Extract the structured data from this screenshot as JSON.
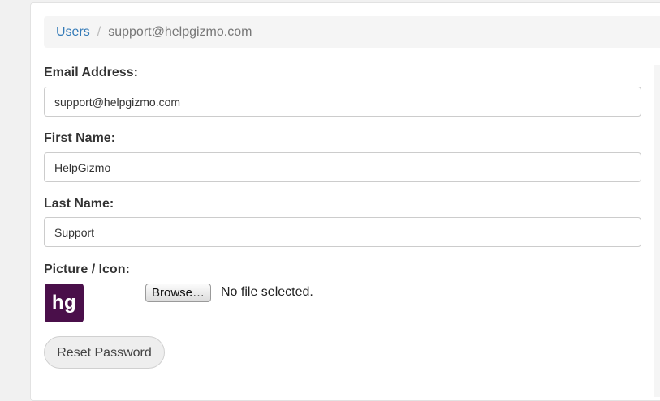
{
  "breadcrumb": {
    "parent_label": "Users",
    "separator": "/",
    "current": "support@helpgizmo.com"
  },
  "form": {
    "email_label": "Email Address:",
    "email_value": "support@helpgizmo.com",
    "first_name_label": "First Name:",
    "first_name_value": "HelpGizmo",
    "last_name_label": "Last Name:",
    "last_name_value": "Support",
    "picture_label": "Picture / Icon:",
    "avatar_text": "hg",
    "browse_label": "Browse…",
    "file_status": "No file selected."
  },
  "actions": {
    "reset_password_label": "Reset Password"
  },
  "colors": {
    "link": "#337ab7",
    "avatar_bg": "#4a0f4a"
  }
}
